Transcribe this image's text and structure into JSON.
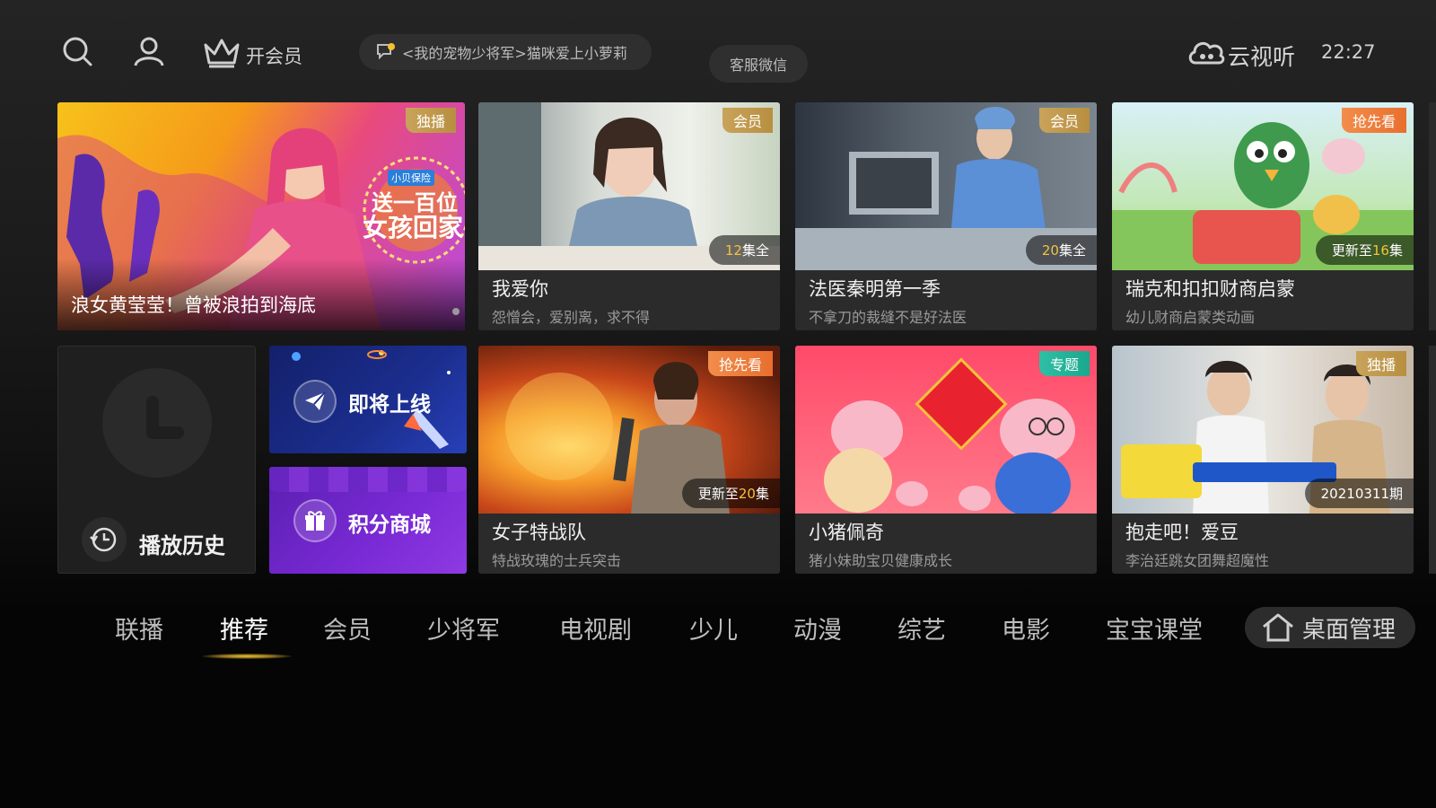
{
  "topbar": {
    "vip_label": "开会员",
    "marquee_text": "<我的宠物少将军>猫咪爱上小萝莉",
    "service_label": "客服微信",
    "brand": "云视听",
    "time": "22:27"
  },
  "banner": {
    "tag": "独播",
    "title": "浪女黄莹莹！曾被浪拍到海底",
    "poster_text_line1": "小贝保险",
    "poster_text_line2": "送一百位",
    "poster_text_line3": "女孩回家",
    "page_count": 3,
    "active_page": 2
  },
  "history": {
    "label": "播放历史"
  },
  "shortcuts": [
    {
      "label": "即将上线"
    },
    {
      "label": "积分商城"
    }
  ],
  "cards_row1": [
    {
      "tag": "会员",
      "badge_num": "12",
      "badge_suffix": "集全",
      "title": "我爱你",
      "subtitle": "怨憎会，爱别离，求不得"
    },
    {
      "tag": "会员",
      "badge_num": "20",
      "badge_suffix": "集全",
      "title": "法医秦明第一季",
      "subtitle": "不拿刀的裁缝不是好法医"
    },
    {
      "tag": "抢先看",
      "badge_prefix": "更新至",
      "badge_num": "16",
      "badge_suffix": "集",
      "title": "瑞克和扣扣财商启蒙",
      "subtitle": "幼儿财商启蒙类动画"
    }
  ],
  "cards_row2": [
    {
      "tag": "抢先看",
      "badge_prefix": "更新至",
      "badge_num": "20",
      "badge_suffix": "集",
      "title": "女子特战队",
      "subtitle": "特战玫瑰的士兵突击"
    },
    {
      "tag": "专题",
      "title": "小猪佩奇",
      "subtitle": "猪小妹助宝贝健康成长"
    },
    {
      "tag": "独播",
      "badge_text": "20210311期",
      "title": "抱走吧！爱豆",
      "subtitle": "李治廷跳女团舞超魔性"
    }
  ],
  "nav": {
    "tabs": [
      {
        "label": "联播"
      },
      {
        "label": "推荐"
      },
      {
        "label": "会员"
      },
      {
        "label": "少将军"
      },
      {
        "label": "电视剧"
      },
      {
        "label": "少儿"
      },
      {
        "label": "动漫"
      },
      {
        "label": "综艺"
      },
      {
        "label": "电影"
      },
      {
        "label": "宝宝课堂"
      }
    ],
    "active_index": 1,
    "desktop_label": "桌面管理"
  },
  "colors": {
    "accent": "#f3c230",
    "vip_tag": "#c9a35a",
    "preview_tag": "#e86f2e",
    "topic_tag": "#1aa88e"
  }
}
